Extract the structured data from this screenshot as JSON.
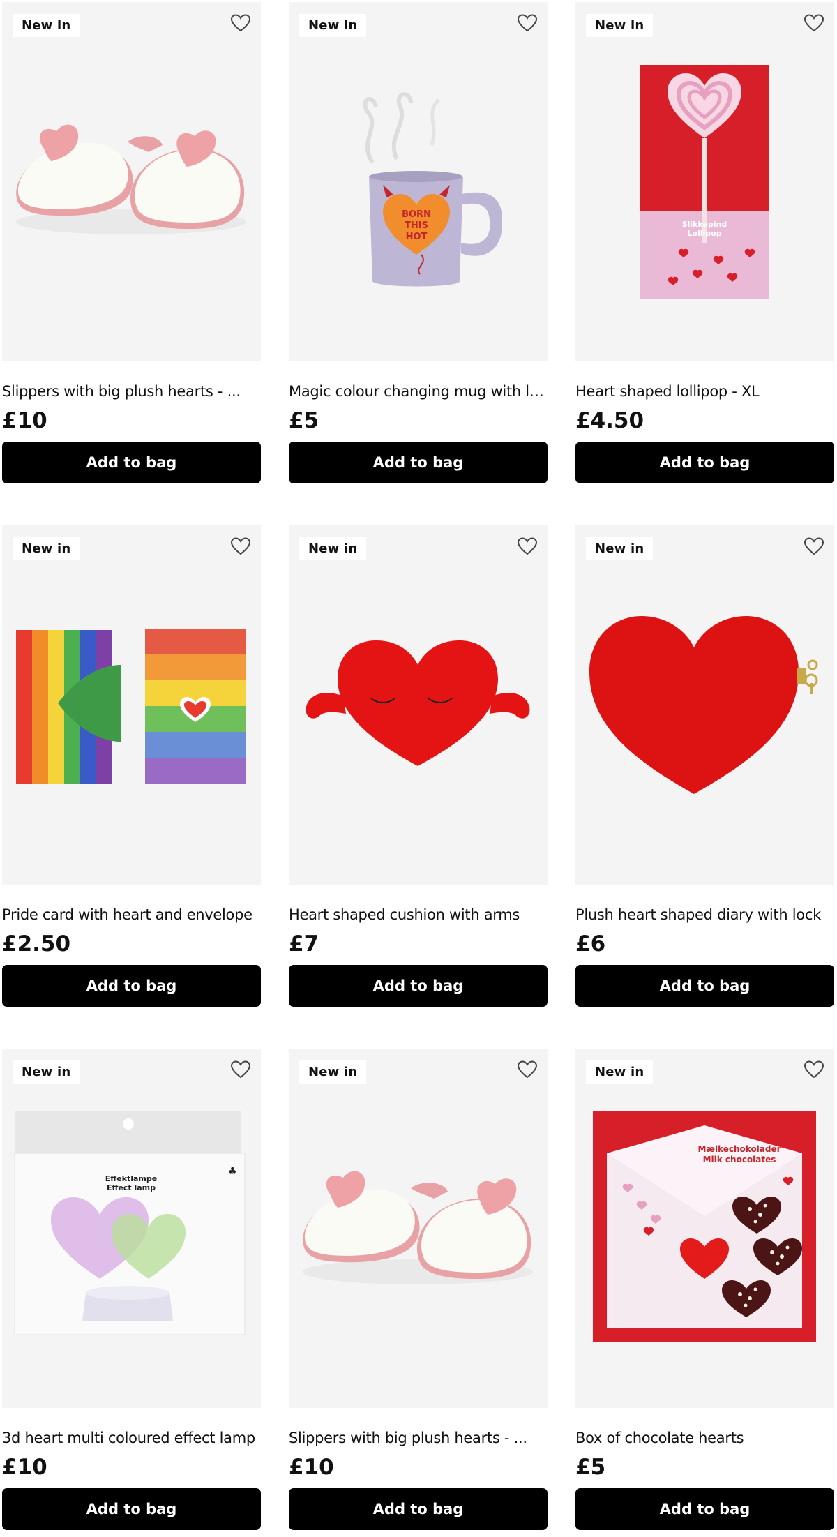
{
  "products": [
    {
      "badge": "New in",
      "title": "Slippers with big plush hearts - ...",
      "price": "£10",
      "button": "Add to bag",
      "image": "slippers",
      "wishlist_icon": "heart-outline-icon"
    },
    {
      "badge": "New in",
      "title": "Magic colour changing mug with lips",
      "price": "£5",
      "button": "Add to bag",
      "image": "mug",
      "image_text": "BORN THIS HOT",
      "wishlist_icon": "heart-outline-icon"
    },
    {
      "badge": "New in",
      "title": "Heart shaped lollipop - XL",
      "price": "£4.50",
      "button": "Add to bag",
      "image": "lollipop",
      "image_text": "Slikkepind Lollipop",
      "wishlist_icon": "heart-outline-icon"
    },
    {
      "badge": "New in",
      "title": "Pride card with heart and envelope",
      "price": "£2.50",
      "button": "Add to bag",
      "image": "pride-card",
      "wishlist_icon": "heart-outline-icon"
    },
    {
      "badge": "New in",
      "title": "Heart shaped cushion with arms",
      "price": "£7",
      "button": "Add to bag",
      "image": "cushion",
      "wishlist_icon": "heart-outline-icon"
    },
    {
      "badge": "New in",
      "title": "Plush heart shaped diary with lock",
      "price": "£6",
      "button": "Add to bag",
      "image": "diary",
      "wishlist_icon": "heart-outline-icon"
    },
    {
      "badge": "New in",
      "title": "3d heart multi coloured effect lamp",
      "price": "£10",
      "button": "Add to bag",
      "image": "lamp",
      "image_text": "Effektlampe Effect lamp",
      "wishlist_icon": "heart-outline-icon"
    },
    {
      "badge": "New in",
      "title": "Slippers with big plush hearts - ...",
      "price": "£10",
      "button": "Add to bag",
      "image": "slippers",
      "wishlist_icon": "heart-outline-icon"
    },
    {
      "badge": "New in",
      "title": "Box of chocolate hearts",
      "price": "£5",
      "button": "Add to bag",
      "image": "chocolates",
      "image_text": "Mælkechokolader Milk chocolates",
      "wishlist_icon": "heart-outline-icon"
    }
  ],
  "colors": {
    "button_bg": "#000000",
    "button_text": "#ffffff",
    "image_bg": "#f4f4f4"
  }
}
